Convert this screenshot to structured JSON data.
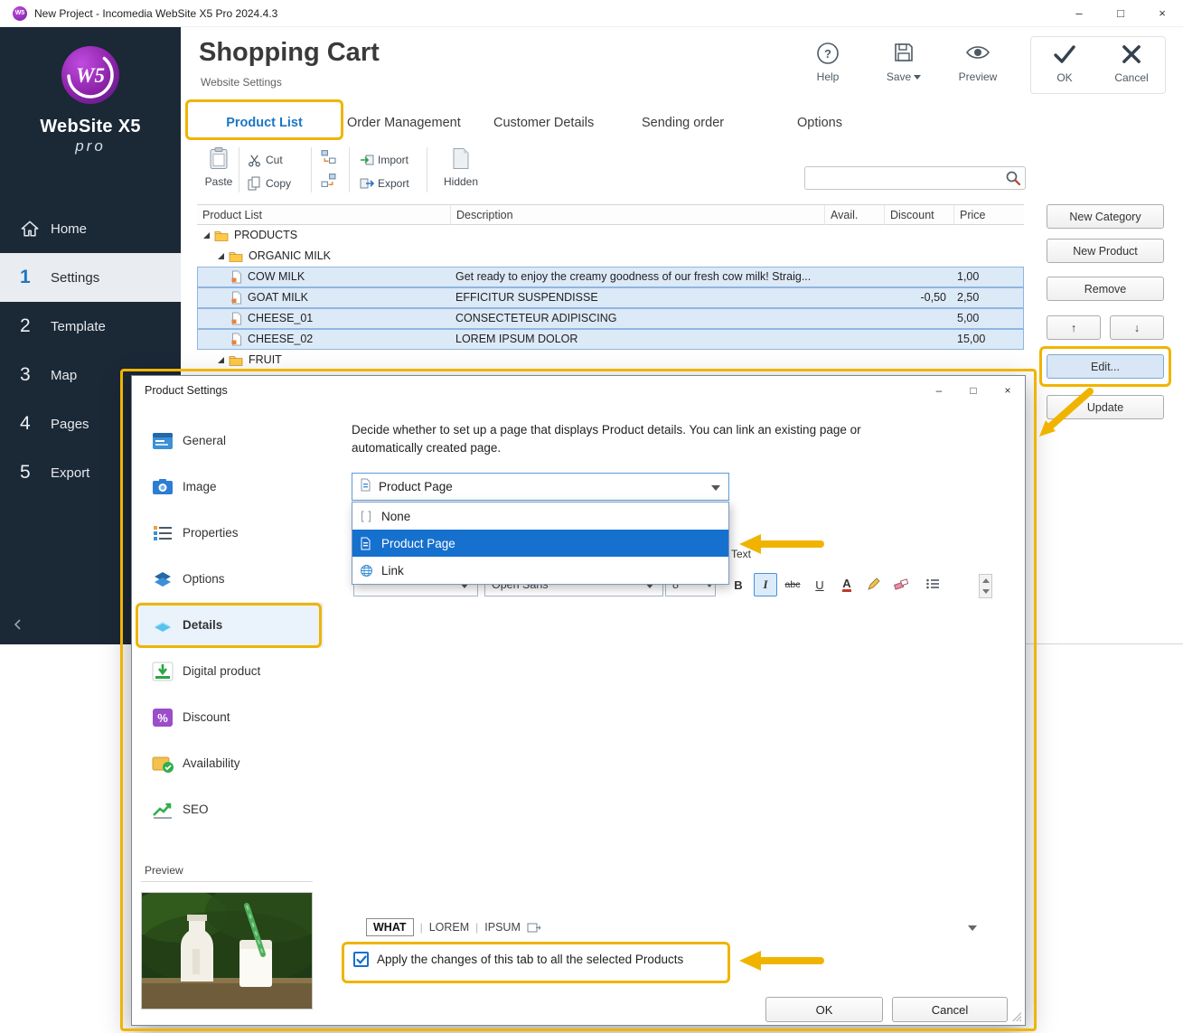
{
  "colors": {
    "annotation": "#F0B400",
    "accent": "#1670CE",
    "sidebar_bg": "#1B2836",
    "selection": "#DCE9F7"
  },
  "window": {
    "title": "New Project - Incomedia WebSite X5 Pro 2024.4.3",
    "logo_badge": "W5",
    "controls": {
      "minimize": "–",
      "maximize": "□",
      "close": "×"
    }
  },
  "sidebar": {
    "logo_title": "WebSite X5",
    "logo_sub": "pro",
    "items": [
      {
        "label": "Home",
        "icon": "home"
      },
      {
        "label": "Settings",
        "number": "1",
        "selected": true
      },
      {
        "label": "Template",
        "number": "2"
      },
      {
        "label": "Map",
        "number": "3"
      },
      {
        "label": "Pages",
        "number": "4"
      },
      {
        "label": "Export",
        "number": "5"
      }
    ]
  },
  "header": {
    "title": "Shopping Cart",
    "subtitle": "Website Settings",
    "help": "Help",
    "save": "Save",
    "preview": "Preview",
    "ok": "OK",
    "cancel": "Cancel"
  },
  "tabs": {
    "active": "Product List",
    "items": [
      "Product List",
      "Order Management",
      "Customer Details",
      "Sending order",
      "Options"
    ]
  },
  "toolbar": {
    "paste": "Paste",
    "cut": "Cut",
    "copy": "Copy",
    "import": "Import",
    "export": "Export",
    "hidden": "Hidden",
    "search_value": ""
  },
  "table": {
    "columns": [
      "Product List",
      "Description",
      "Avail.",
      "Discount",
      "Price"
    ],
    "rows": [
      {
        "type": "category",
        "level": 0,
        "name": "PRODUCTS",
        "expanded": true
      },
      {
        "type": "category",
        "level": 1,
        "name": "ORGANIC MILK",
        "expanded": true
      },
      {
        "type": "product",
        "level": 2,
        "name": "COW MILK",
        "description": "Get ready to enjoy the creamy goodness of our fresh cow milk! Straig...",
        "availability": "",
        "discount": "",
        "price": "1,00",
        "selected": true
      },
      {
        "type": "product",
        "level": 2,
        "name": "GOAT MILK",
        "description": "EFFICITUR SUSPENDISSE",
        "availability": "",
        "discount": "-0,50",
        "price": "2,50",
        "selected": true
      },
      {
        "type": "product",
        "level": 2,
        "name": "CHEESE_01",
        "description": "CONSECTETEUR ADIPISCING",
        "availability": "",
        "discount": "",
        "price": "5,00",
        "selected": true
      },
      {
        "type": "product",
        "level": 2,
        "name": "CHEESE_02",
        "description": "LOREM IPSUM DOLOR",
        "availability": "",
        "discount": "",
        "price": "15,00",
        "selected": true
      },
      {
        "type": "category",
        "level": 1,
        "name": "FRUIT",
        "expanded": true
      }
    ]
  },
  "side_buttons": {
    "new_category": "New Category",
    "new_product": "New Product",
    "remove": "Remove",
    "move_up": "↑",
    "move_down": "↓",
    "edit": "Edit...",
    "update": "Update"
  },
  "dialog": {
    "title": "Product Settings",
    "controls": {
      "minimize": "–",
      "maximize": "□",
      "close": "×"
    },
    "nav": {
      "active": "Details",
      "items": [
        "General",
        "Image",
        "Properties",
        "Options",
        "Details",
        "Digital product",
        "Discount",
        "Availability",
        "SEO"
      ]
    },
    "preview_label": "Preview",
    "details": {
      "description": "Decide whether to set up a page that displays Product details. You can link an existing page or automatically created page.",
      "page_combo": {
        "value": "Product Page",
        "options": [
          "None",
          "Product Page",
          "Link"
        ],
        "selected": "Product Page"
      },
      "text_label": "Text",
      "editor": {
        "font_name": "Open Sans",
        "font_size": "8",
        "bold": "B",
        "italic": "I",
        "strike": "abc",
        "underline": "U",
        "color": "A",
        "tabs": [
          "WHAT",
          "LOREM",
          "IPSUM"
        ],
        "active_tab": "WHAT"
      },
      "apply_label": "Apply the changes of this tab to all the selected Products",
      "apply_checked": true
    },
    "ok": "OK",
    "cancel": "Cancel"
  }
}
